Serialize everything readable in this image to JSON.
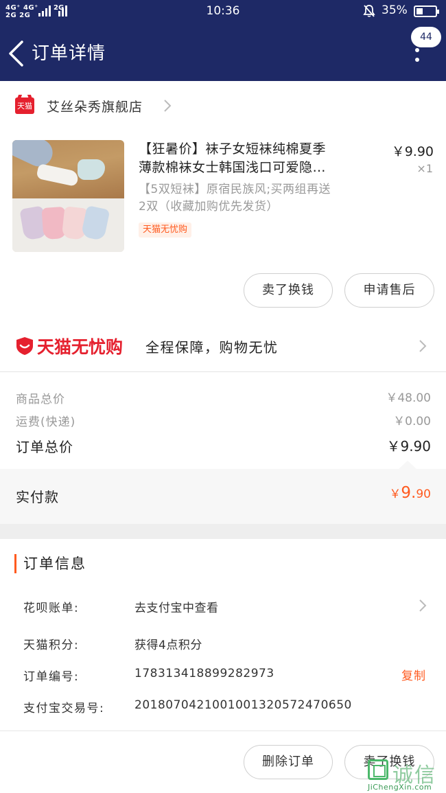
{
  "status_bar": {
    "network": [
      "4G⁺",
      "4G⁺",
      "2G",
      "2G"
    ],
    "network_2g": "2G",
    "time": "10:36",
    "battery_pct": "35%",
    "battery_level": 0.35
  },
  "header": {
    "title": "订单详情",
    "message_count": "44"
  },
  "store": {
    "tag": "天猫",
    "name": "艾丝朵秀旗舰店"
  },
  "product": {
    "title_line1": "【狂暑价】袜子女短袜纯棉夏季",
    "title_line2": "薄款棉袜女士韩国浅口可爱隐…",
    "sku_line1": "【5双短袜】原宿民族风;买两组再送",
    "sku_line2": "2双（收藏加购优先发货）",
    "badge": "天猫无忧购",
    "price": "￥9.90",
    "qty": "×1",
    "buttons": {
      "sell": "卖了换钱",
      "after_sale": "申请售后"
    }
  },
  "guarantee": {
    "brand": "天猫无忧购",
    "text": "全程保障，购物无忧"
  },
  "summary": {
    "goods_label": "商品总价",
    "goods_value": "￥48.00",
    "shipping_label": "运费(快递)",
    "shipping_value": "￥0.00",
    "total_label": "订单总价",
    "total_value": "￥9.90",
    "paid_label": "实付款",
    "paid_currency": "￥",
    "paid_int": "9.",
    "paid_dec": "90"
  },
  "order_info": {
    "title": "订单信息",
    "rows": [
      {
        "label": "花呗账单:",
        "value": "去支付宝中查看"
      },
      {
        "label": "天猫积分:",
        "value": "获得4点积分"
      },
      {
        "label": "订单编号:",
        "value": "178313418899282973"
      },
      {
        "label": "支付宝交易号:",
        "value": "2018070421001001320572470650"
      }
    ],
    "copy": "复制"
  },
  "bottom": {
    "delete": "删除订单",
    "sell": "卖了换钱"
  },
  "watermark": {
    "cn": "诚信",
    "en": "JiChengXin.com"
  },
  "colors": {
    "header_bg": "#1e2966",
    "accent_orange": "#ff5a1f",
    "tmall_red": "#e5202e"
  }
}
